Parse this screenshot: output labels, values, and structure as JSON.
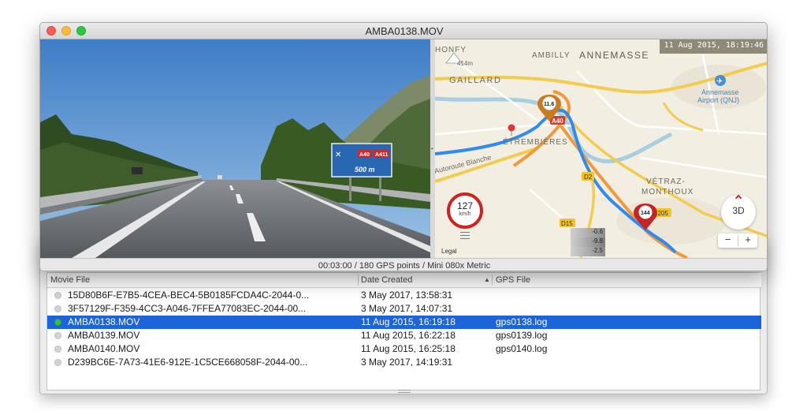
{
  "window": {
    "title": "AMBA0138.MOV",
    "status": "00:03:00 / 180 GPS points / Mini 080x Metric"
  },
  "video": {
    "sign_exit_a40": "A40",
    "sign_exit_a411": "A411",
    "sign_distance": "500 m"
  },
  "map": {
    "timestamp": "11 Aug 2015, 18:19:46",
    "places": {
      "honfy": "HONFY",
      "ambilly": "AMBILLY",
      "annemasse": "ANNEMASSE",
      "gaillard": "GAILLARD",
      "airport_line1": "Annemasse",
      "airport_line2": "Airport (QNJ)",
      "etrembieres": "ÉTREMBIÈRES",
      "autoroute": "Autoroute Blanche",
      "vetraz1": "VÉTRAZ-",
      "vetraz2": "MONTHOUX",
      "elevation": "414m"
    },
    "roads": {
      "a40": "A40",
      "d2": "D2",
      "d15": "D15",
      "d1205": "1205"
    },
    "markers": {
      "start_value": "11.6",
      "current_value": "144"
    },
    "speed": {
      "value": "127",
      "unit": "km/h"
    },
    "accel": [
      "-0.6",
      "-9.8",
      "-2.5"
    ],
    "button_3d": "3D",
    "zoom_out": "−",
    "zoom_in": "+",
    "legal": "Legal",
    "colors": {
      "route": "#2f8bf2",
      "start_marker": "#c97b22",
      "current_marker": "#c62525",
      "speed_ring": "#d12222"
    }
  },
  "file_list": {
    "columns": {
      "movie": "Movie File",
      "date": "Date Created",
      "gps": "GPS File"
    },
    "rows": [
      {
        "movie": "15D80B6F-E7B5-4CEA-BEC4-5B0185FCDA4C-2044-0...",
        "date": "3 May 2017, 13:58:31",
        "gps": "",
        "active": false,
        "selected": false
      },
      {
        "movie": "3F57129F-F359-4CC3-A046-7FFEA77083EC-2044-00...",
        "date": "3 May 2017, 14:07:31",
        "gps": "",
        "active": false,
        "selected": false
      },
      {
        "movie": "AMBA0138.MOV",
        "date": "11 Aug 2015, 16:19:18",
        "gps": "gps0138.log",
        "active": true,
        "selected": true
      },
      {
        "movie": "AMBA0139.MOV",
        "date": "11 Aug 2015, 16:22:18",
        "gps": "gps0139.log",
        "active": false,
        "selected": false
      },
      {
        "movie": "AMBA0140.MOV",
        "date": "11 Aug 2015, 16:25:18",
        "gps": "gps0140.log",
        "active": false,
        "selected": false
      },
      {
        "movie": "D239BC6E-7A73-41E6-912E-1C5CE668058F-2044-00...",
        "date": "3 May 2017, 14:19:31",
        "gps": "",
        "active": false,
        "selected": false
      }
    ]
  }
}
